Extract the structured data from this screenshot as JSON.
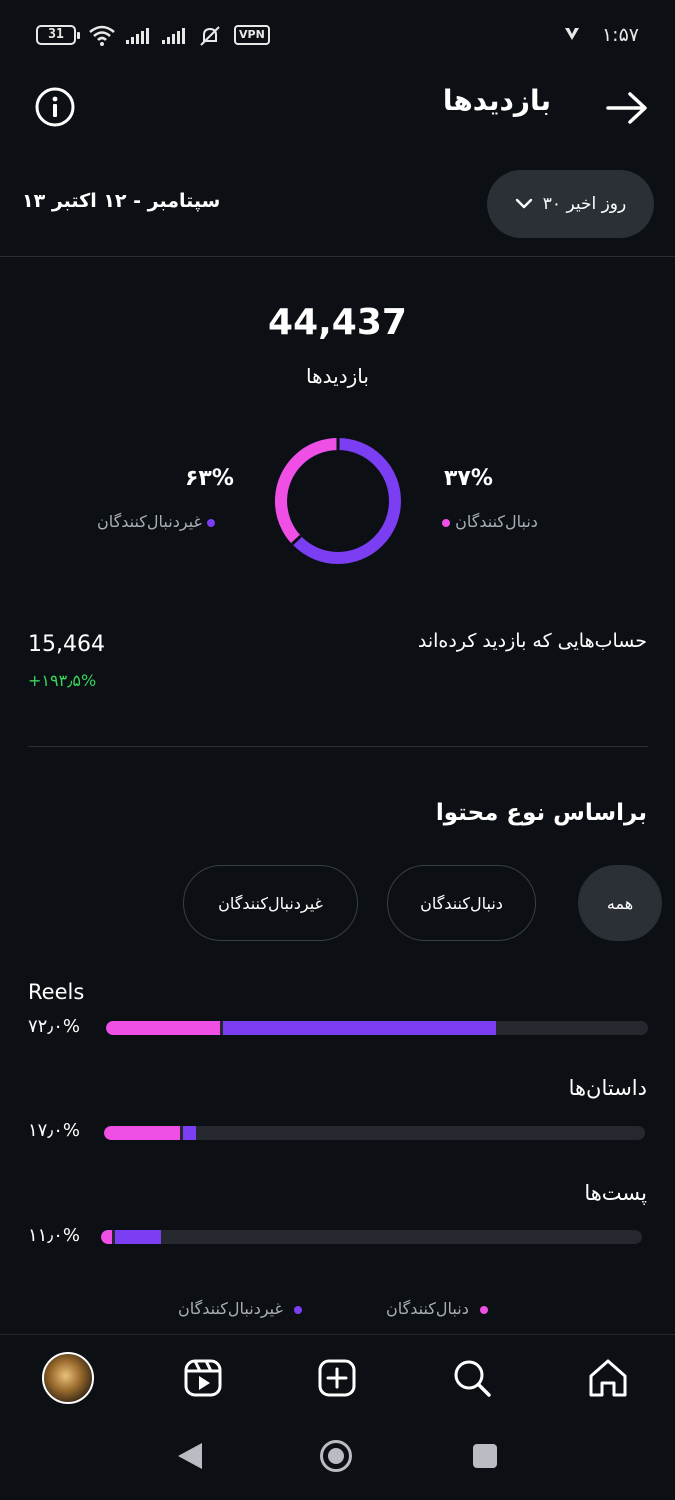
{
  "status_bar": {
    "battery": "31",
    "vpn": "VPN",
    "time": "۱:۵۷"
  },
  "header": {
    "title": "بازدیدها",
    "info_icon": "info-icon",
    "back_icon": "arrow-right-icon"
  },
  "filter": {
    "date_range": "۱۳ سپتامبر - ۱۲ اکتبر",
    "dropdown_label": "۳۰ روز اخیر"
  },
  "summary": {
    "total": "44,437",
    "total_label": "بازدیدها",
    "followers_pct": "۳۷%",
    "followers_label": "دنبال‌کنندگان",
    "followers_fraction": 0.37,
    "non_followers_pct": "۶۳%",
    "non_followers_label": "غیردنبال‌کنندگان",
    "non_followers_fraction": 0.63
  },
  "accounts": {
    "label": "حساب‌هایی که بازدید کرده‌اند",
    "value": "15,464",
    "change": "+۱۹۳٫۵%"
  },
  "content_type": {
    "title": "براساس نوع محتوا",
    "chips": [
      "همه",
      "دنبال‌کنندگان",
      "غیردنبال‌کنندگان"
    ],
    "selected_chip": "همه",
    "bars": [
      {
        "label": "Reels",
        "pct": "۷۲٫۰%",
        "total": 0.72,
        "followers": 0.21,
        "non_followers": 0.51
      },
      {
        "label": "داستان‌ها",
        "pct": "۱۷٫۰%",
        "total": 0.17,
        "followers": 0.14,
        "non_followers": 0.03
      },
      {
        "label": "پست‌ها",
        "pct": "۱۱٫۰%",
        "total": 0.11,
        "followers": 0.02,
        "non_followers": 0.09
      }
    ],
    "legend": {
      "followers": "دنبال‌کنندگان",
      "non_followers": "غیردنبال‌کنندگان"
    }
  },
  "colors": {
    "followers": "#ef4fe5",
    "non_followers": "#7b3ef2",
    "positive": "#3ad55c",
    "background": "#0c0f14"
  },
  "bottom_nav": [
    "profile-avatar",
    "reels-icon",
    "create-icon",
    "search-icon",
    "home-icon"
  ],
  "system_nav": [
    "back-icon",
    "home-circle-icon",
    "recents-icon"
  ]
}
